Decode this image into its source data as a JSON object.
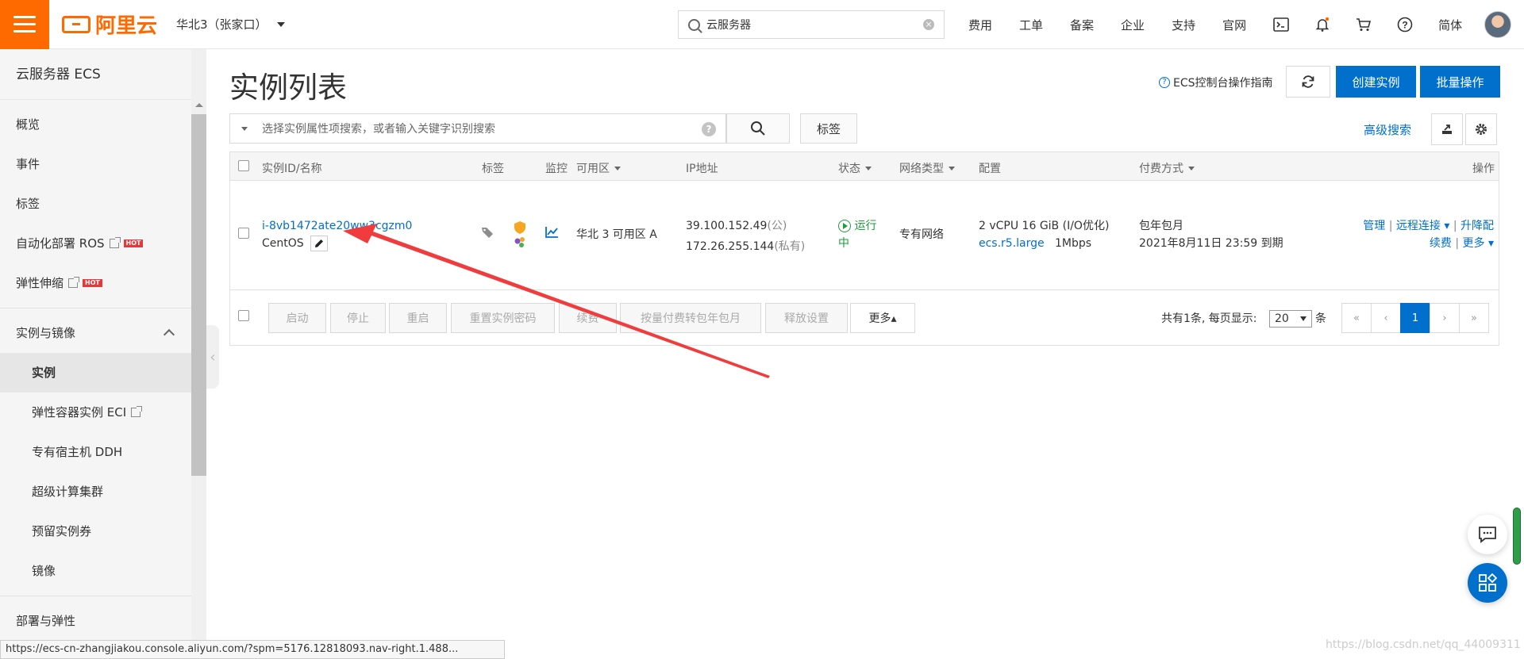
{
  "header": {
    "logo_text": "阿里云",
    "region": "华北3（张家口）",
    "search_value": "云服务器",
    "nav": [
      "费用",
      "工单",
      "备案",
      "企业",
      "支持",
      "官网"
    ],
    "lang": "简体"
  },
  "sidebar": {
    "title": "云服务器 ECS",
    "items": [
      {
        "label": "概览"
      },
      {
        "label": "事件"
      },
      {
        "label": "标签"
      },
      {
        "label": "自动化部署 ROS",
        "hot": "HOT"
      },
      {
        "label": "弹性伸缩",
        "hot": "HOT"
      }
    ],
    "group": "实例与镜像",
    "sub_items": [
      {
        "label": "实例"
      },
      {
        "label": "弹性容器实例 ECI"
      },
      {
        "label": "专有宿主机 DDH"
      },
      {
        "label": "超级计算集群"
      },
      {
        "label": "预留实例券"
      },
      {
        "label": "镜像"
      }
    ],
    "next_group": "部署与弹性"
  },
  "main": {
    "title": "实例列表",
    "guide_link": "ECS控制台操作指南",
    "create_button": "创建实例",
    "batch_button": "批量操作",
    "filter_placeholder": "选择实例属性项搜索，或者输入关键字识别搜索",
    "tag_button": "标签",
    "advanced_search": "高级搜索"
  },
  "table": {
    "columns": {
      "id_name": "实例ID/名称",
      "tags": "标签",
      "monitor": "监控",
      "zone": "可用区",
      "ip": "IP地址",
      "status": "状态",
      "network": "网络类型",
      "config": "配置",
      "billing": "付费方式",
      "actions": "操作"
    },
    "row": {
      "instance_id": "i-8vb1472ate20ww3cgzm0",
      "name": "CentOS",
      "zone": "华北 3 可用区 A",
      "public_ip": "39.100.152.49",
      "public_suffix": "(公)",
      "private_ip": "172.26.255.144",
      "private_suffix": "(私有)",
      "status_line1": "运行",
      "status_line2": "中",
      "network": "专有网络",
      "config_line1": "2 vCPU 16 GiB (I/O优化)",
      "config_type": "ecs.r5.large",
      "config_bw": "1Mbps",
      "billing_line1": "包年包月",
      "billing_line2": "2021年8月11日 23:59 到期",
      "actions": {
        "manage": "管理",
        "remote": "远程连接",
        "upgrade": "升降配",
        "renew": "续费",
        "more": "更多"
      }
    },
    "bulk": [
      "启动",
      "停止",
      "重启",
      "重置实例密码",
      "续费",
      "按量付费转包年包月",
      "释放设置",
      "更多▴"
    ],
    "pagination": {
      "summary": "共有1条, 每页显示:",
      "page_size": "20",
      "unit": "条",
      "first": "«",
      "prev": "‹",
      "current": "1",
      "next": "›",
      "last": "»"
    }
  },
  "statusbar_url": "https://ecs-cn-zhangjiakou.console.aliyun.com/?spm=5176.12818093.nav-right.1.488...",
  "watermark": "https://blog.csdn.net/qq_44009311",
  "colors": {
    "brand_orange": "#ff6a00",
    "primary_blue": "#0070cc",
    "running_green": "#1e9e3a",
    "annotation_red": "#f03c3c"
  }
}
